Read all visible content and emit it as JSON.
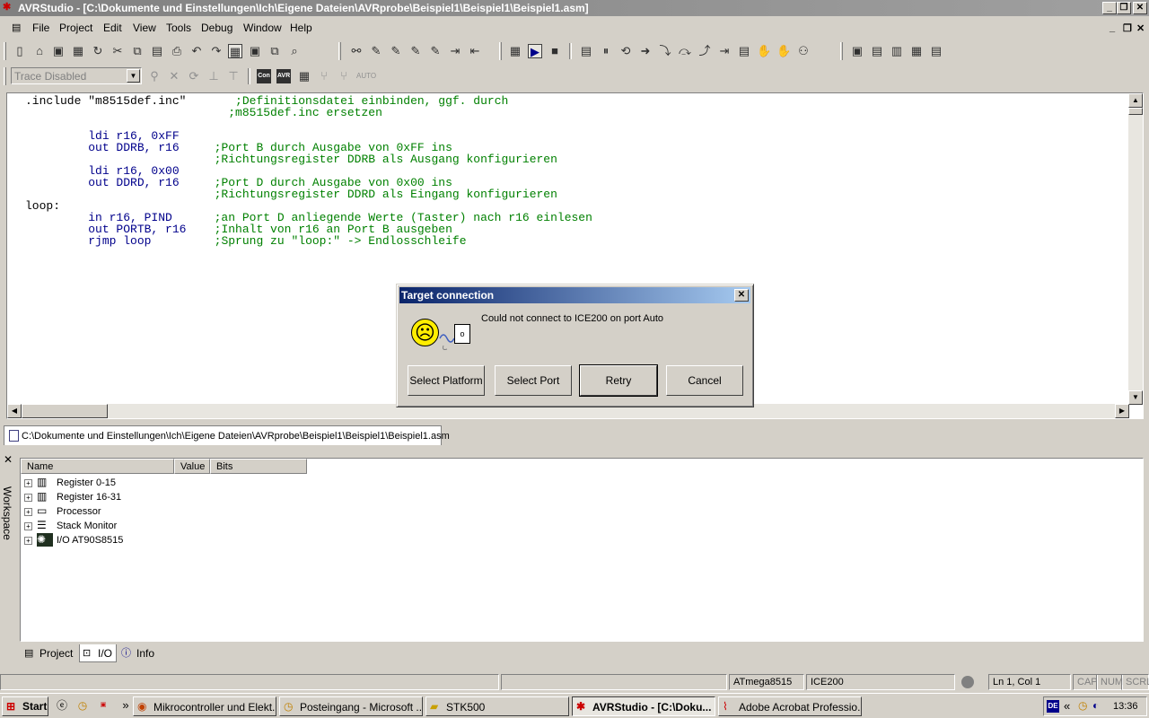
{
  "window": {
    "title": "AVRStudio - [C:\\Dokumente und Einstellungen\\Ich\\Eigene Dateien\\AVRprobe\\Beispiel1\\Beispiel1\\Beispiel1.asm]",
    "app_icon": "avr-bug-icon",
    "min_glyph": "_",
    "max_glyph": "❐",
    "close_glyph": "✕"
  },
  "menu": {
    "items": [
      "File",
      "Project",
      "View",
      "Tools",
      "Debug",
      "Window",
      "Help"
    ],
    "mdi_min": "_",
    "mdi_restore": "❐",
    "mdi_close": "✕"
  },
  "toolbar2": {
    "trace_select_value": "Trace Disabled",
    "auto_label": "AUTO",
    "con_label": "Con",
    "avr_label": "AVR"
  },
  "editor": {
    "lines": [
      {
        "a": ".include \"m8515def.inc\"",
        "b": "       ;Definitionsdatei einbinden, ggf. durch"
      },
      {
        "a": "",
        "b": "                             ;m8515def.inc ersetzen"
      },
      {
        "a": "",
        "b": ""
      },
      {
        "a": "         ldi r16, 0xFF",
        "b": ""
      },
      {
        "a": "         out DDRB, r16",
        "b": "     ;Port B durch Ausgabe von 0xFF ins"
      },
      {
        "a": "",
        "b": "                           ;Richtungsregister DDRB als Ausgang konfigurieren"
      },
      {
        "a": "         ldi r16, 0x00",
        "b": ""
      },
      {
        "a": "         out DDRD, r16",
        "b": "     ;Port D durch Ausgabe von 0x00 ins"
      },
      {
        "a": "",
        "b": "                           ;Richtungsregister DDRD als Eingang konfigurieren"
      },
      {
        "a": "loop:",
        "b": ""
      },
      {
        "a": "         in r16, PIND",
        "b": "      ;an Port D anliegende Werte (Taster) nach r16 einlesen"
      },
      {
        "a": "         out PORTB, r16",
        "b": "    ;Inhalt von r16 an Port B ausgeben"
      },
      {
        "a": "         rjmp loop",
        "b": "         ;Sprung zu \"loop:\" -> Endlosschleife"
      }
    ]
  },
  "file_tab": "C:\\Dokumente und Einstellungen\\Ich\\Eigene Dateien\\AVRprobe\\Beispiel1\\Beispiel1\\Beispiel1.asm",
  "workspace": {
    "label": "Workspace",
    "close_glyph": "✕",
    "columns": [
      "Name",
      "Value",
      "Bits"
    ],
    "rows": [
      {
        "label": "Register 0-15",
        "icon": "register-icon"
      },
      {
        "label": "Register 16-31",
        "icon": "register-icon"
      },
      {
        "label": "Processor",
        "icon": "processor-icon"
      },
      {
        "label": "Stack Monitor",
        "icon": "stack-icon"
      },
      {
        "label": "I/O AT90S8515",
        "icon": "chip-icon"
      }
    ],
    "tabs": [
      "Project",
      "I/O",
      "Info"
    ]
  },
  "statusbar": {
    "device": "ATmega8515",
    "platform": "ICE200",
    "position": "Ln 1, Col 1",
    "cap": "CAP",
    "num": "NUM",
    "scrl": "SCRL"
  },
  "taskbar": {
    "start": "Start",
    "tasks": [
      "Mikrocontroller und Elekt...",
      "Posteingang - Microsoft ...",
      "STK500",
      "AVRStudio - [C:\\Doku...",
      "Adobe Acrobat Professio..."
    ],
    "lang": "DE",
    "clock": "13:36",
    "chevron": "»",
    "tray_chevron": "«"
  },
  "dialog": {
    "title": "Target connection",
    "message": "Could not connect to ICE200 on port Auto",
    "buttons": [
      "Select Platform",
      "Select Port",
      "Retry",
      "Cancel"
    ],
    "close_glyph": "✕",
    "smiley": "☹",
    "plug": "o"
  },
  "colors": {
    "dialog_title": "#0a246a",
    "code_keyword": "#00008b",
    "code_comment": "#008000"
  }
}
